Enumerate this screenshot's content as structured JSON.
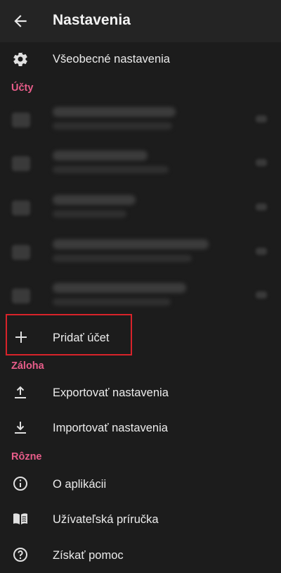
{
  "header": {
    "title": "Nastavenia"
  },
  "general": {
    "label": "Všeobecné nastavenia"
  },
  "sections": {
    "accounts": "Účty",
    "backup": "Záloha",
    "misc": "Rôzne"
  },
  "accounts_actions": {
    "add_account": "Pridať účet"
  },
  "backup": {
    "export": "Exportovať nastavenia",
    "import": "Importovať nastavenia"
  },
  "misc": {
    "about": "O aplikácii",
    "guide": "Užívateľská príručka",
    "help": "Získať pomoc"
  },
  "colors": {
    "background": "#1c1c1c",
    "appbar": "#242424",
    "accent": "#e85d8a",
    "highlight": "#d8232a"
  },
  "icons": {
    "back": "arrow-back-icon",
    "general": "gear-icon",
    "add": "plus-icon",
    "export": "upload-icon",
    "import": "download-icon",
    "about": "info-icon",
    "guide": "book-icon",
    "help": "help-circle-icon"
  }
}
